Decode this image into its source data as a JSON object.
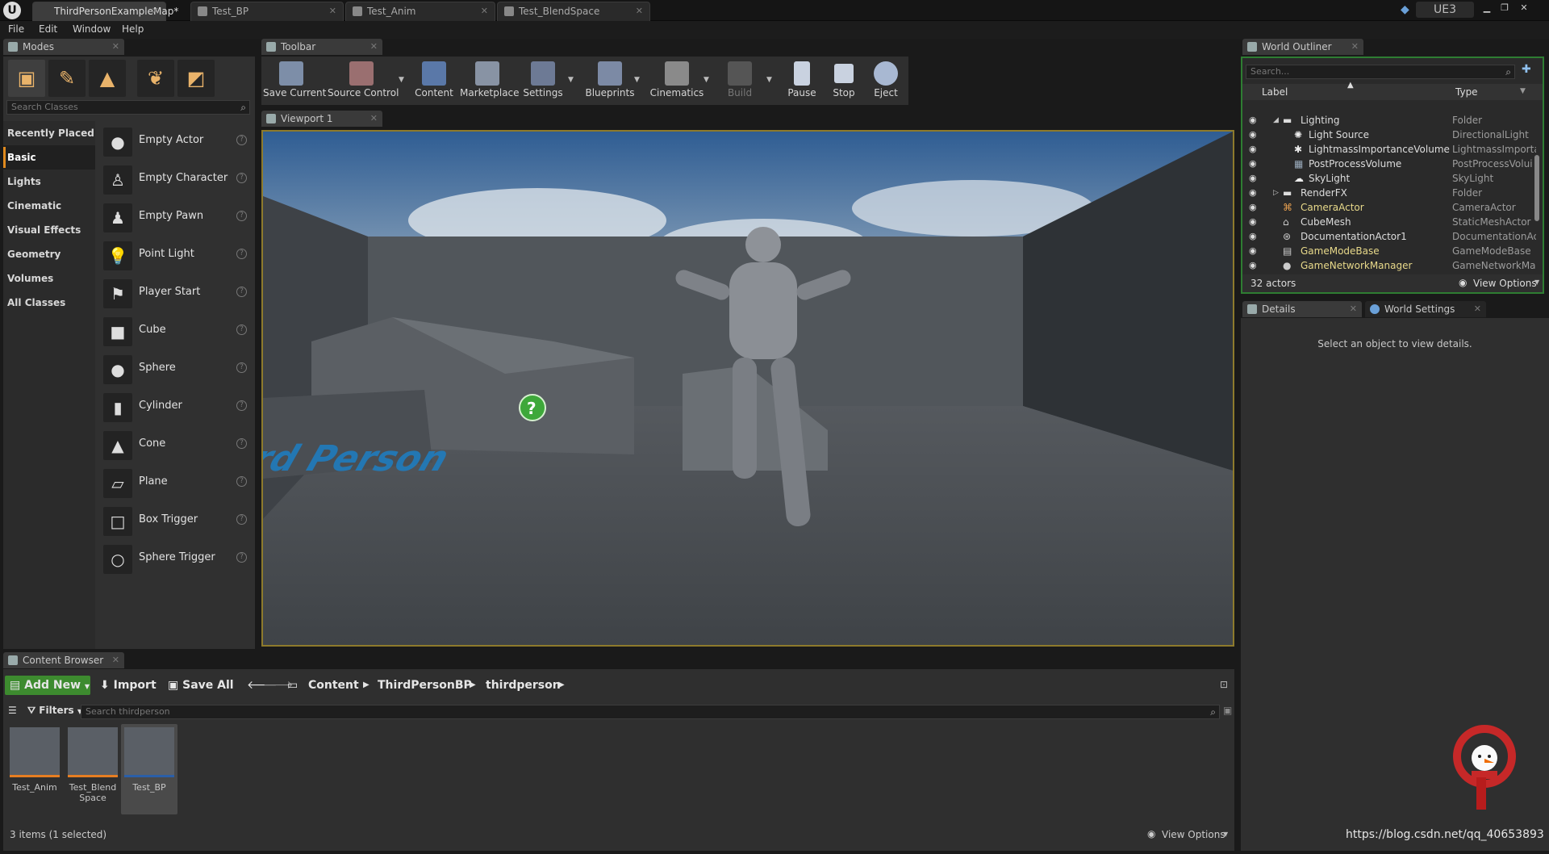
{
  "titlebar": {
    "tabs": [
      {
        "label": "ThirdPersonExampleMap*"
      },
      {
        "label": "Test_BP"
      },
      {
        "label": "Test_Anim"
      },
      {
        "label": "Test_BlendSpace"
      }
    ],
    "profile_label": "UE3"
  },
  "menu": {
    "items": [
      "File",
      "Edit",
      "Window",
      "Help"
    ]
  },
  "modes": {
    "tab_label": "Modes",
    "search_placeholder": "Search Classes",
    "categories": [
      "Recently Placed",
      "Basic",
      "Lights",
      "Cinematic",
      "Visual Effects",
      "Geometry",
      "Volumes",
      "All Classes"
    ],
    "active_category": "Basic",
    "classes": [
      "Empty Actor",
      "Empty Character",
      "Empty Pawn",
      "Point Light",
      "Player Start",
      "Cube",
      "Sphere",
      "Cylinder",
      "Cone",
      "Plane",
      "Box Trigger",
      "Sphere Trigger"
    ]
  },
  "toolbar": {
    "tab_label": "Toolbar",
    "buttons": [
      "Save Current",
      "Source Control",
      "Content",
      "Marketplace",
      "Settings",
      "Blueprints",
      "Cinematics",
      "Build",
      "Pause",
      "Stop",
      "Eject"
    ]
  },
  "viewport": {
    "tab_label": "Viewport 1",
    "floor_text": "Third Person"
  },
  "outliner": {
    "tab_label": "World Outliner",
    "search_placeholder": "Search...",
    "col_label": "Label",
    "col_type": "Type",
    "rows": [
      {
        "label": "Lighting",
        "type": "Folder"
      },
      {
        "label": "Light Source",
        "type": "DirectionalLight"
      },
      {
        "label": "LightmassImportanceVolume",
        "type": "LightmassImporta"
      },
      {
        "label": "PostProcessVolume",
        "type": "PostProcessVolui"
      },
      {
        "label": "SkyLight",
        "type": "SkyLight"
      },
      {
        "label": "RenderFX",
        "type": "Folder"
      },
      {
        "label": "CameraActor",
        "type": "CameraActor"
      },
      {
        "label": "CubeMesh",
        "type": "StaticMeshActor"
      },
      {
        "label": "DocumentationActor1",
        "type": "DocumentationAc"
      },
      {
        "label": "GameModeBase",
        "type": "GameModeBase"
      },
      {
        "label": "GameNetworkManager",
        "type": "GameNetworkMar"
      }
    ],
    "actor_count": "32 actors",
    "view_options": "View Options"
  },
  "details": {
    "tab_label": "Details",
    "world_settings_label": "World Settings",
    "empty_text": "Select an object to view details."
  },
  "content_browser": {
    "tab_label": "Content Browser",
    "add_new": "Add New",
    "import": "Import",
    "save_all": "Save All",
    "path": [
      "Content",
      "ThirdPersonBP",
      "thirdperson"
    ],
    "filters": "Filters",
    "search_placeholder": "Search thirdperson",
    "assets": [
      {
        "label": "Test_Anim"
      },
      {
        "label": "Test_Blend Space"
      },
      {
        "label": "Test_BP"
      }
    ],
    "status": "3 items (1 selected)",
    "view_options": "View Options"
  },
  "watermark": "https://blog.csdn.net/qq_40653893",
  "colors": {
    "accent_orange": "#e08a1e",
    "outliner_border": "#2e7d32",
    "viewport_border": "#8d7a2c",
    "add_new_green": "#3d8b2f"
  }
}
